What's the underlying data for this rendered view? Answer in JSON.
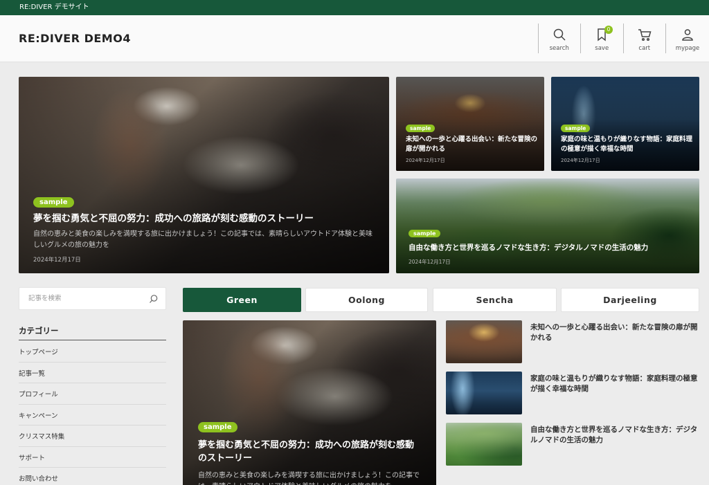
{
  "topbar": {
    "text": "RE:DIVER デモサイト"
  },
  "header": {
    "logo": "RE:DIVER DEMO4",
    "nav": [
      {
        "icon": "search-icon",
        "label": "search"
      },
      {
        "icon": "bookmark-icon",
        "label": "save",
        "badge": "0"
      },
      {
        "icon": "cart-icon",
        "label": "cart"
      },
      {
        "icon": "user-icon",
        "label": "mypage"
      }
    ]
  },
  "hero": {
    "main": {
      "tag": "sample",
      "title": "夢を掴む勇気と不屈の努力：成功への旅路が刻む感動のストーリー",
      "excerpt": "自然の恵みと美食の楽しみを満喫する旅に出かけましょう！この記事では、素晴らしいアウトドア体験と美味しいグルメの旅の魅力を",
      "date": "2024年12月17日"
    },
    "side1": {
      "tag": "sample",
      "title": "未知への一歩と心躍る出会い：新たな冒険の扉が開かれる",
      "date": "2024年12月17日"
    },
    "side2": {
      "tag": "sample",
      "title": "家庭の味と温もりが織りなす物語：家庭料理の極意が描く幸福な時間",
      "date": "2024年12月17日"
    },
    "wide": {
      "tag": "sample",
      "title": "自由な働き方と世界を巡るノマドな生き方：デジタルノマドの生活の魅力",
      "date": "2024年12月17日"
    }
  },
  "sidebar": {
    "search_placeholder": "記事を検索",
    "category_heading": "カテゴリー",
    "categories": [
      "トップページ",
      "記事一覧",
      "プロフィール",
      "キャンペーン",
      "クリスマス特集",
      "サポート",
      "お問い合わせ"
    ]
  },
  "tabs": [
    "Green",
    "Oolong",
    "Sencha",
    "Darjeeling"
  ],
  "feature": {
    "tag": "sample",
    "title": "夢を掴む勇気と不屈の努力：成功への旅路が刻む感動のストーリー",
    "excerpt": "自然の恵みと美食の楽しみを満喫する旅に出かけましょう！この記事では、素晴らしいアウトドア体験と美味しいグルメの旅の魅力を"
  },
  "list": [
    {
      "title": "未知への一歩と心躍る出会い：新たな冒険の扉が開かれる"
    },
    {
      "title": "家庭の味と温もりが織りなす物語：家庭料理の極意が描く幸福な時間"
    },
    {
      "title": "自由な働き方と世界を巡るノマドな生き方：デジタルノマドの生活の魅力"
    }
  ],
  "colors": {
    "brand": "#17583a",
    "tag": "#8ec21f",
    "background": "#ececec"
  }
}
